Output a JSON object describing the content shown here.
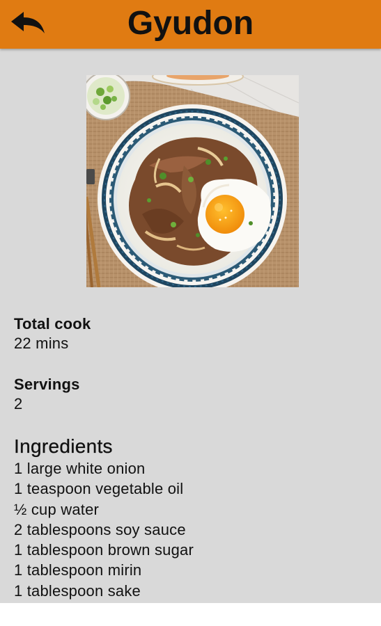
{
  "header": {
    "title": "Gyudon",
    "back_icon": "back-arrow-icon",
    "background_color": "#e07b12"
  },
  "image": {
    "subject": "gyudon-bowl-photo"
  },
  "details": {
    "total_cook_label": "Total cook",
    "total_cook_value": "22 mins",
    "servings_label": "Servings",
    "servings_value": "2"
  },
  "ingredients": {
    "heading": "Ingredients",
    "items": [
      "1 large white onion",
      "1 teaspoon vegetable oil",
      "½ cup water",
      "2 tablespoons soy sauce",
      "1 tablespoon brown sugar",
      "1 tablespoon mirin",
      "1 tablespoon sake"
    ]
  }
}
